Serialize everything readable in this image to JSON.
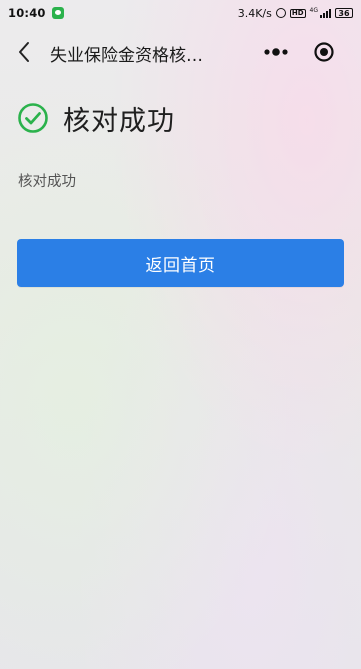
{
  "status_bar": {
    "time": "10:40",
    "net_speed": "3.4K/s",
    "hd_label": "HD",
    "network_label": "4G",
    "battery": "36"
  },
  "nav": {
    "title": "失业保险金资格核…",
    "more_icon": "more-dots-icon",
    "close_icon": "target-icon"
  },
  "result": {
    "icon": "check-circle-icon",
    "title": "核对成功",
    "description": "核对成功",
    "accent_color": "#2bb24c"
  },
  "actions": {
    "home_label": "返回首页",
    "home_color": "#2b7fe6"
  }
}
